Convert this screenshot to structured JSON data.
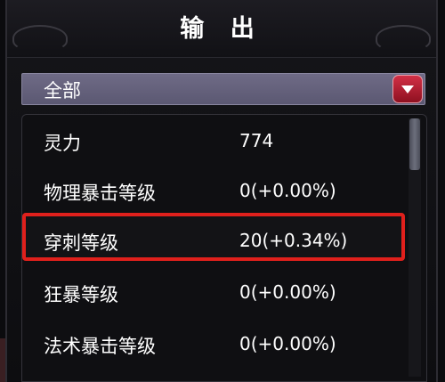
{
  "window": {
    "title": "输 出"
  },
  "filter": {
    "selected": "全部",
    "button_icon": "dropdown-arrow-icon"
  },
  "stats": [
    {
      "label": "灵力",
      "value": "774"
    },
    {
      "label": "物理暴击等级",
      "value": "0(+0.00%)"
    },
    {
      "label": "穿刺等级",
      "value": "20(+0.34%)"
    },
    {
      "label": "狂暴等级",
      "value": "0(+0.00%)"
    },
    {
      "label": "法术暴击等级",
      "value": "0(+0.00%)"
    }
  ],
  "colors": {
    "highlight_border": "#e0201c",
    "dropdown_bg": "#6f6b86",
    "dropdown_button": "#c0283c"
  }
}
